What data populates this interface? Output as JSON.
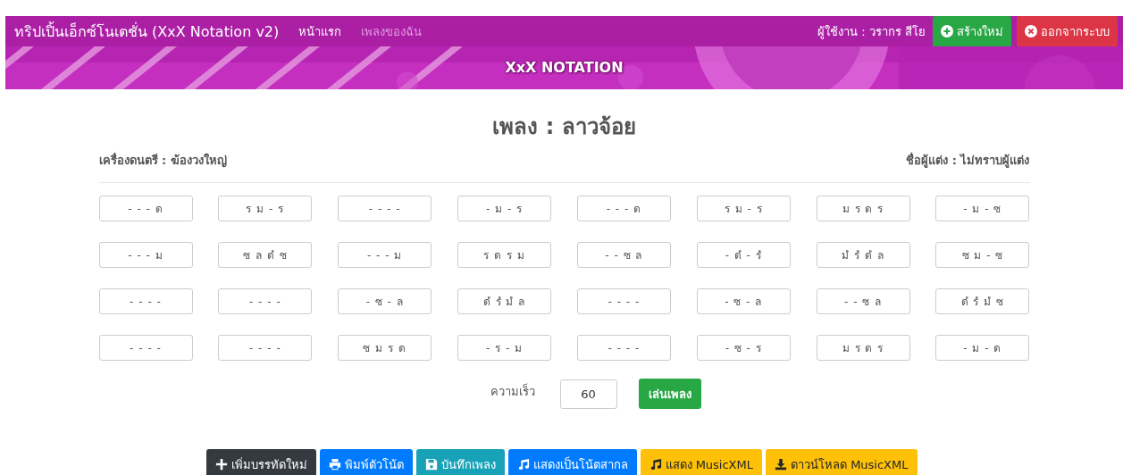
{
  "navbar": {
    "brand": "ทริปเปิ้นเอ็กซ์โนเตชั่น (XxX Notation v2)",
    "links": [
      {
        "label": "หน้าแรก",
        "selected": true
      },
      {
        "label": "เพลงของฉัน",
        "selected": false
      }
    ],
    "user": "ผู้ใช้งาน : วรากร สีโย",
    "buttons": [
      {
        "label": "สร้างใหม่",
        "kind": "create"
      },
      {
        "label": "ออกจากระบบ",
        "kind": "logout"
      }
    ]
  },
  "banner": {
    "kind": "picture",
    "title": "XxX NOTATION"
  },
  "song": {
    "title": "เพลง : ลาวจ้อย",
    "instrument": "เครื่องดนตรี : ฆ้องวงใหญ่",
    "composer": "ชื่อผู้แต่ง : ไม่ทราบผู้แต่ง"
  },
  "notes": [
    [
      "- - - ด",
      "ร ม - ร",
      "- - - -",
      "- ม - ร",
      "- - - ด",
      "ร ม - ร",
      "ม ร ด ร",
      "- ม - ซ"
    ],
    [
      "- - - ม",
      "ซ ล ดํ ซ",
      "- - - ม",
      "ร ด ร ม",
      "- - ซ ล",
      "- ดํ - รํ",
      "มํ รํ ดํ ล",
      "ซ ม - ซ"
    ],
    [
      "- - - -",
      "- - - -",
      "- ซ - ล",
      "ดํ รํ มํ ล",
      "- - - -",
      "- ซ - ล",
      "- - ซ ล",
      "ดํ รํ มํ ซ"
    ],
    [
      "- - - -",
      "- - - -",
      "ซ ม ร ด",
      "- ร - ม",
      "- - - -",
      "- ซ - ร",
      "ม ร ด ร",
      "- ม - ด"
    ]
  ],
  "player": {
    "speed_label": "ความเร็ว",
    "speed": "60",
    "play_button": "เล่นเพลง"
  },
  "actions": [
    {
      "label": "เพิ่มบรรทัดใหม่",
      "kind": "add"
    },
    {
      "label": "พิมพ์ตัวโน้ต",
      "kind": "print"
    },
    {
      "label": "บันทึกเพลง",
      "kind": "save"
    },
    {
      "label": "แสดงเป็นโน้ตสากล",
      "kind": "score"
    },
    {
      "label": "แสดง MusicXML",
      "kind": "xml"
    },
    {
      "label": "ดาวน์โหลด MusicXML",
      "kind": "download"
    }
  ]
}
